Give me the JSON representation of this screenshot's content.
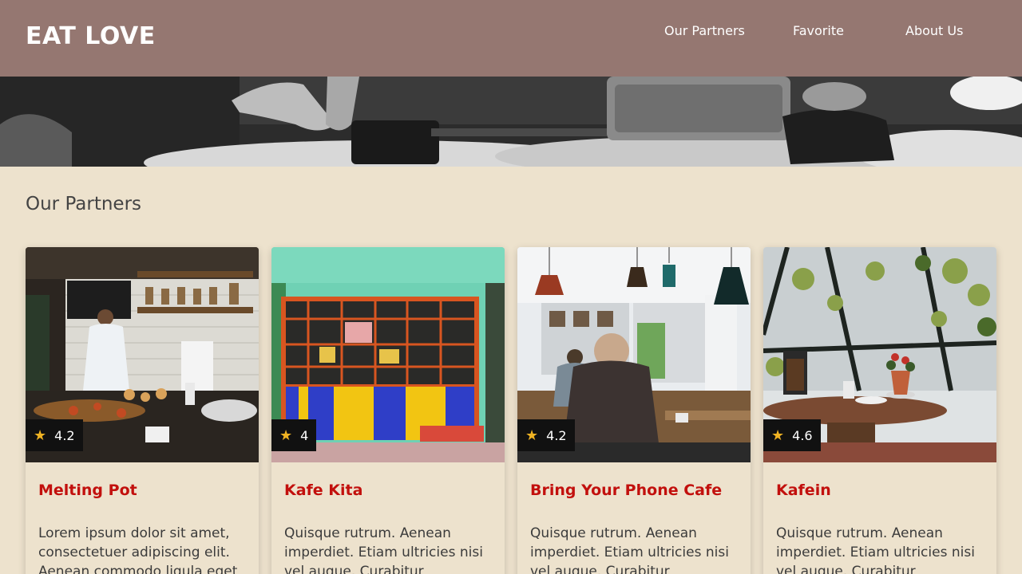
{
  "brand": {
    "name": "EAT LOVE"
  },
  "nav": {
    "items": [
      {
        "label": "Our Partners"
      },
      {
        "label": "Favorite"
      },
      {
        "label": "About Us"
      }
    ]
  },
  "hero": {
    "icon": "hero-food-photo"
  },
  "section": {
    "title": "Our Partners"
  },
  "partners": [
    {
      "name": "Melting Pot",
      "rating": "4.2",
      "description": "Lorem ipsum dolor sit amet, consectetuer adipiscing elit. Aenean commodo ligula eget dolor."
    },
    {
      "name": "Kafe Kita",
      "rating": "4",
      "description": "Quisque rutrum. Aenean imperdiet. Etiam ultricies nisi vel augue. Curabitur ullamcorper ultricies nisi."
    },
    {
      "name": "Bring Your Phone Cafe",
      "rating": "4.2",
      "description": "Quisque rutrum. Aenean imperdiet. Etiam ultricies nisi vel augue. Curabitur ullamcorper ultricies nisi."
    },
    {
      "name": "Kafein",
      "rating": "4.6",
      "description": "Quisque rutrum. Aenean imperdiet. Etiam ultricies nisi vel augue. Curabitur ullamcorper ultricies nisi."
    }
  ],
  "colors": {
    "header_bg": "#957771",
    "page_bg": "#ede2cd",
    "title_red": "#c2100d",
    "star": "#f0b323"
  }
}
